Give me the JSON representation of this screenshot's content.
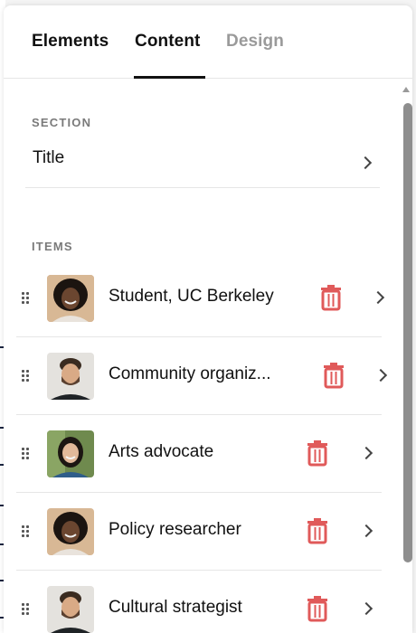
{
  "tabs": [
    {
      "label": "Elements",
      "active": false
    },
    {
      "label": "Content",
      "active": true
    },
    {
      "label": "Design",
      "active": false
    }
  ],
  "section": {
    "heading": "SECTION",
    "title_label": "Title"
  },
  "items_heading": "ITEMS",
  "items": [
    {
      "label": "Student, UC Berkeley",
      "avatar": "woman-curly-hair-avatar"
    },
    {
      "label": "Community organiz...",
      "avatar": "man-beard-avatar"
    },
    {
      "label": "Arts advocate",
      "avatar": "woman-long-hair-avatar"
    },
    {
      "label": "Policy researcher",
      "avatar": "woman-curly-hair-avatar"
    },
    {
      "label": "Cultural strategist",
      "avatar": "man-beard-avatar"
    }
  ],
  "colors": {
    "accent_text": "#111111",
    "dim_tab": "#9a9a9a",
    "delete_icon": "#e05a5a",
    "divider": "#e6e6e6"
  }
}
